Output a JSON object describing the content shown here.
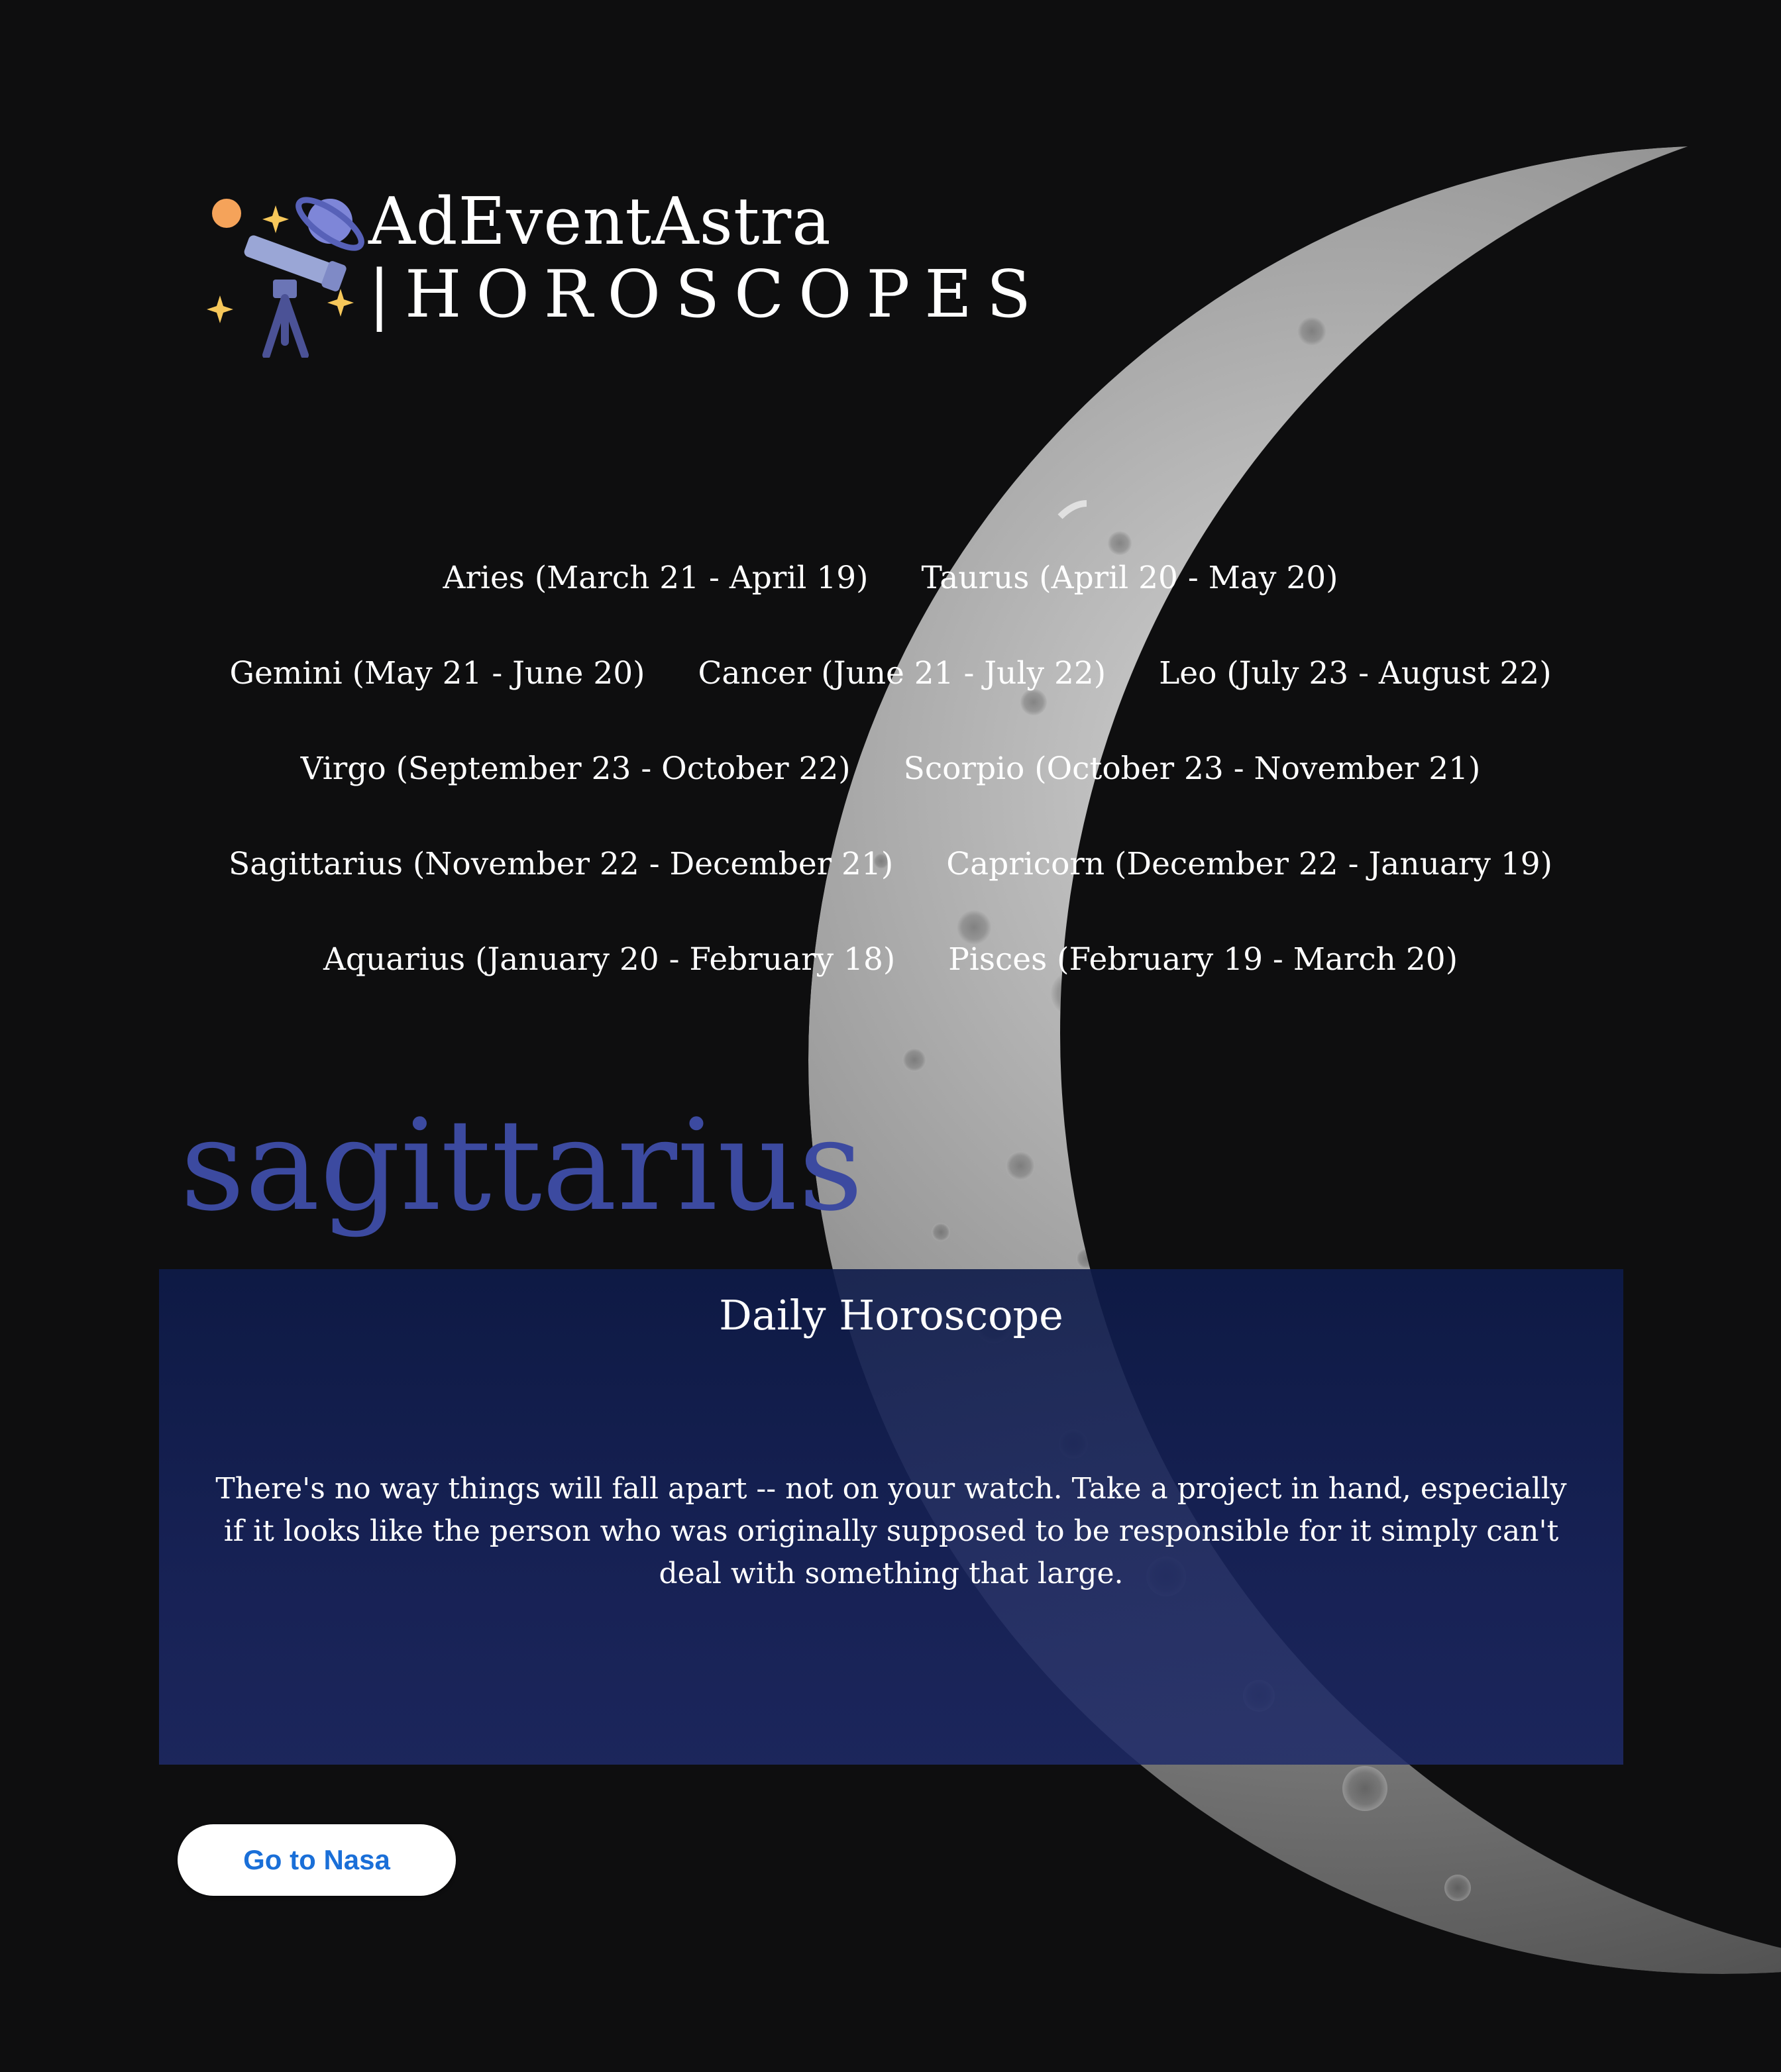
{
  "brand": {
    "title": "AdEventAstra",
    "subtitle": "|HOROSCOPES",
    "logo_icon": "telescope-planets-icon"
  },
  "nav": {
    "rows": [
      [
        {
          "label": "Aries (March 21 - April 19)"
        },
        {
          "label": "Taurus (April 20 - May 20)"
        }
      ],
      [
        {
          "label": "Gemini (May 21 - June 20)"
        },
        {
          "label": "Cancer (June 21 - July 22)"
        },
        {
          "label": "Leo (July 23 - August 22)"
        }
      ],
      [
        {
          "label": "Virgo (September 23 - October 22)"
        },
        {
          "label": "Scorpio (October 23 - November 21)"
        }
      ],
      [
        {
          "label": "Sagittarius (November 22 - December 21)"
        },
        {
          "label": "Capricorn (December 22 - January 19)"
        }
      ],
      [
        {
          "label": "Aquarius (January 20 - February 18)"
        },
        {
          "label": "Pisces (February 19 - March 20)"
        }
      ]
    ]
  },
  "selected_sign": "sagittarius",
  "horoscope": {
    "heading": "Daily Horoscope",
    "text": "There's no way things will fall apart -- not on your watch. Take a project in hand, especially if it looks like the person who was originally supposed to be responsible for it simply can't deal with something that large."
  },
  "actions": {
    "nasa_button": "Go to Nasa"
  },
  "colors": {
    "background": "#0e0e0f",
    "sign_heading": "#3c4aa0",
    "panel": "#16225a",
    "button_text": "#1a6fd8"
  }
}
